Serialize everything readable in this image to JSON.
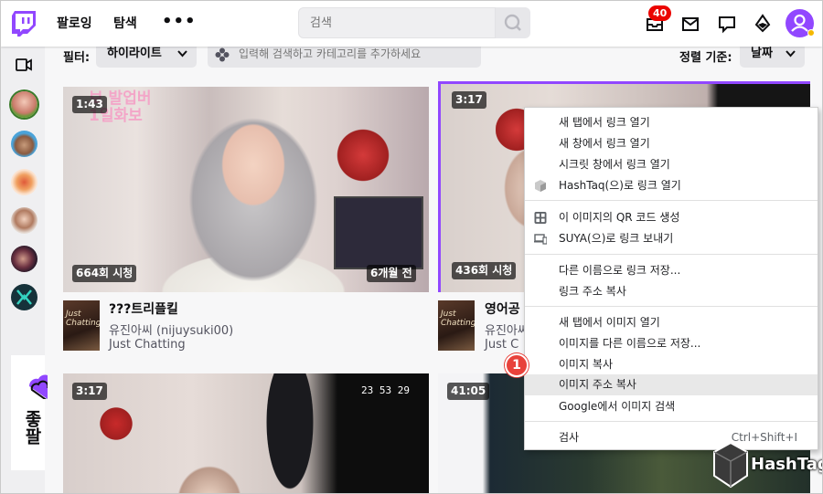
{
  "nav": {
    "following": "팔로잉",
    "browse": "탐색",
    "more": "•••",
    "search_placeholder": "검색",
    "notification_count": "40"
  },
  "filter": {
    "filter_label": "필터:",
    "filter_value": "하이라이트",
    "category_placeholder": "입력해 검색하고 카테고리를 추가하세요",
    "sort_label": "정렬 기준:",
    "sort_value": "날짜"
  },
  "rail": {
    "card_title": "좋팔"
  },
  "videos": [
    {
      "duration": "1:43",
      "views": "664회 시청",
      "age": "6개월 전",
      "title": "???트리플킬",
      "channel": "유진아씨 (nijuysuki00)",
      "category": "Just Chatting",
      "overlay": "보 발업버\n1일화보"
    },
    {
      "duration": "3:17",
      "views": "436회 시청",
      "title": "영어공",
      "channel": "유진아씨",
      "category": "Just C"
    },
    {
      "duration": "3:17"
    },
    {
      "duration": "41:05"
    }
  ],
  "context_menu": {
    "items": [
      {
        "label": "새 탭에서 링크 열기",
        "icon": ""
      },
      {
        "label": "새 창에서 링크 열기",
        "icon": ""
      },
      {
        "label": "시크릿 창에서 링크 열기",
        "icon": ""
      },
      {
        "label": "HashTaq(으)로 링크 열기",
        "icon": "hashtaq-icon"
      },
      {
        "label": "이 이미지의 QR 코드 생성",
        "icon": "qr-icon"
      },
      {
        "label": "SUYA(으)로 링크 보내기",
        "icon": "device-icon"
      },
      {
        "label": "다른 이름으로 링크 저장...",
        "icon": ""
      },
      {
        "label": "링크 주소 복사",
        "icon": ""
      },
      {
        "label": "새 탭에서 이미지 열기",
        "icon": ""
      },
      {
        "label": "이미지를 다른 이름으로 저장...",
        "icon": ""
      },
      {
        "label": "이미지 복사",
        "icon": ""
      },
      {
        "label": "이미지 주소 복사",
        "icon": "",
        "highlighted": true
      },
      {
        "label": "Google에서 이미지 검색",
        "icon": ""
      },
      {
        "label": "검사",
        "icon": "",
        "shortcut": "Ctrl+Shift+I"
      }
    ]
  },
  "marker": "1",
  "watermark": "HashTag",
  "colors": {
    "brand": "#9147ff",
    "badge": "#eb0400",
    "marker": "#e8423b"
  }
}
